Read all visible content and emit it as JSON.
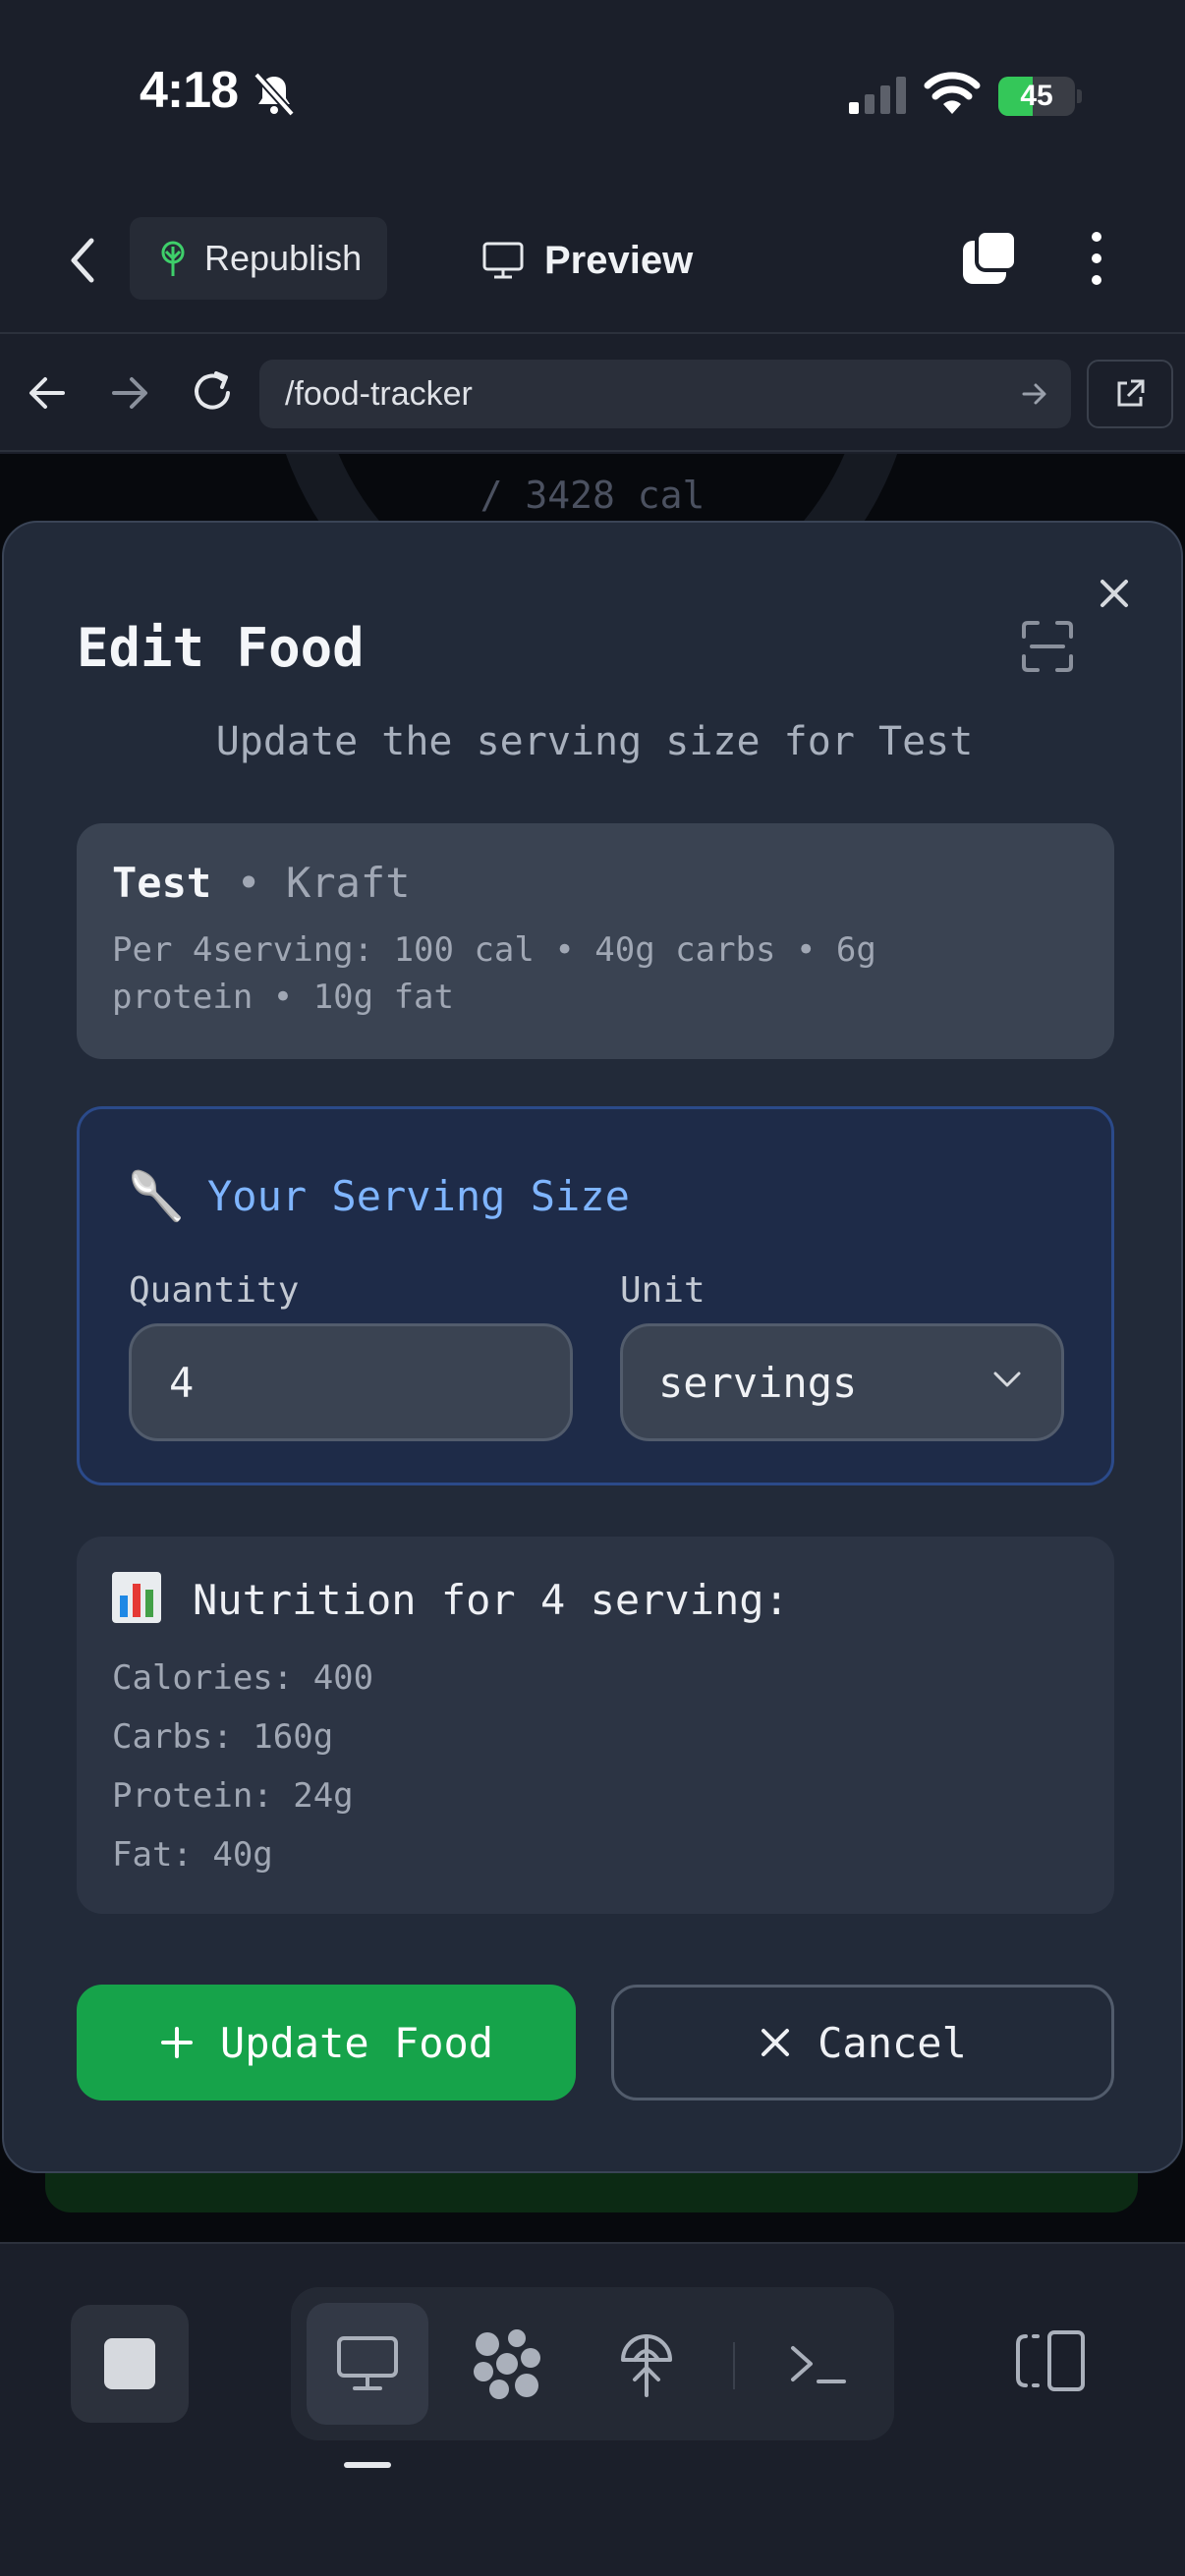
{
  "status_bar": {
    "time": "4:18",
    "battery_level": "45",
    "battery_fill_fraction": 0.45,
    "battery_color": "#34c759",
    "icons": [
      "bell-slash-icon",
      "cellular-signal-icon",
      "wifi-icon",
      "battery-charging-icon"
    ]
  },
  "header": {
    "republish_label": "Republish",
    "preview_label": "Preview",
    "icons": [
      "chevron-left-icon",
      "sprout-icon",
      "monitor-icon",
      "tabs-icon",
      "more-vertical-icon"
    ]
  },
  "address_bar": {
    "url": "/food-tracker",
    "icons": [
      "arrow-left-icon",
      "arrow-right-icon",
      "reload-icon",
      "go-arrow-icon",
      "external-link-icon"
    ]
  },
  "background_page": {
    "calorie_goal_text": "/ 3428 cal"
  },
  "modal": {
    "title": "Edit Food",
    "subtitle": "Update the serving size for Test",
    "food": {
      "name": "Test",
      "separator": "•",
      "brand": "Kraft",
      "detail": "Per 4serving: 100 cal • 40g carbs • 6g protein • 10g fat"
    },
    "serving": {
      "icon": "🥄",
      "title": "Your Serving Size",
      "quantity_label": "Quantity",
      "quantity_value": "4",
      "unit_label": "Unit",
      "unit_value": "servings"
    },
    "nutrition": {
      "title": "Nutrition for 4 serving:",
      "lines": [
        "Calories: 400",
        "Carbs: 160g",
        "Protein: 24g",
        "Fat: 40g"
      ]
    },
    "update_button": "Update Food",
    "cancel_button": "Cancel",
    "accent_color": "#16a34a",
    "highlight_color": "#7fb5ff"
  },
  "bottom_toolbar": {
    "icons": [
      "stop-icon",
      "desktop-icon",
      "grid-apps-icon",
      "deploy-icon",
      "terminal-icon",
      "panel-toggle-icon"
    ]
  }
}
